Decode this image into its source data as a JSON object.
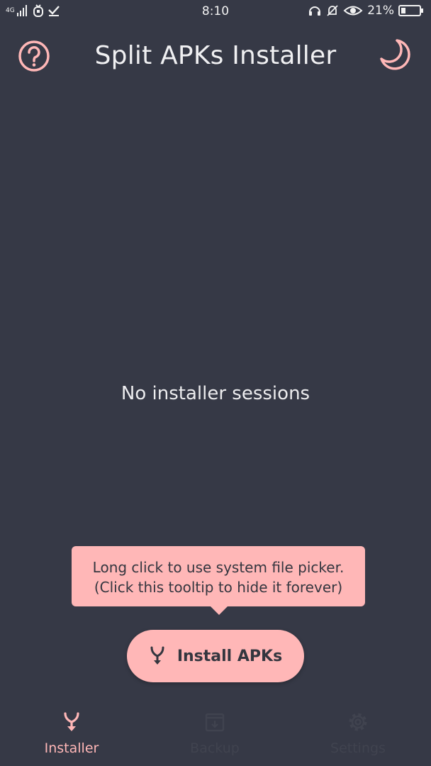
{
  "status_bar": {
    "left_text": "4G",
    "time": "8:10",
    "battery": "21%"
  },
  "app_bar": {
    "title": "Split APKs Installer"
  },
  "main": {
    "empty_message": "No installer sessions"
  },
  "tooltip": {
    "line1": "Long click to use system file picker.",
    "line2": "(Click this tooltip to hide it forever)"
  },
  "fab": {
    "label": "Install APKs"
  },
  "bottom_nav": {
    "items": [
      {
        "label": "Installer",
        "active": true
      },
      {
        "label": "Backup",
        "active": false
      },
      {
        "label": "Settings",
        "active": false
      }
    ]
  },
  "colors": {
    "background": "#363946",
    "accent": "#FFB7B7",
    "text_dark": "#34363F",
    "inactive": "#40434F"
  }
}
